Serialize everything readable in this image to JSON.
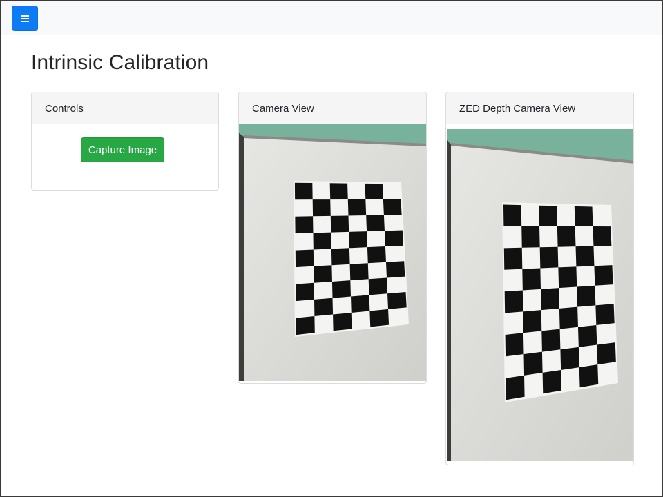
{
  "navbar": {
    "menu_icon": "hamburger-menu-icon",
    "menu_color": "#0d7bf5"
  },
  "page": {
    "title": "Intrinsic Calibration"
  },
  "controls": {
    "header": "Controls",
    "capture_label": "Capture Image",
    "capture_color": "#28a745"
  },
  "camera_view": {
    "header": "Camera View"
  },
  "zed_view": {
    "header": "ZED Depth Camera View"
  },
  "checkerboard": {
    "rows": 9,
    "cols": 6
  }
}
